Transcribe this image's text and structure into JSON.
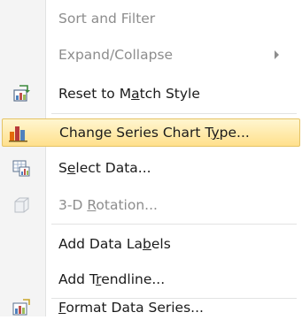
{
  "menu": {
    "items": [
      {
        "label": "Sort and Filter",
        "disabled": true
      },
      {
        "label": "Expand/Collapse",
        "disabled": true,
        "submenu": true
      },
      {
        "pre": "Reset to M",
        "key": "a",
        "post": "tch Style",
        "icon": "reset-style-icon"
      },
      {
        "pre": "Change Series Chart T",
        "key": "y",
        "post": "pe...",
        "icon": "chart-type-icon",
        "highlighted": true
      },
      {
        "pre": "S",
        "key": "e",
        "post": "lect Data...",
        "icon": "select-data-icon"
      },
      {
        "pre": "3-D ",
        "key": "R",
        "post": "otation...",
        "icon": "rotation-3d-icon",
        "disabled": true
      },
      {
        "pre": "Add Data La",
        "key": "b",
        "post": "els"
      },
      {
        "pre": "Add T",
        "key": "r",
        "post": "endline..."
      },
      {
        "pre": "",
        "key": "F",
        "post": "ormat Data Series...",
        "icon": "format-series-icon"
      }
    ]
  }
}
